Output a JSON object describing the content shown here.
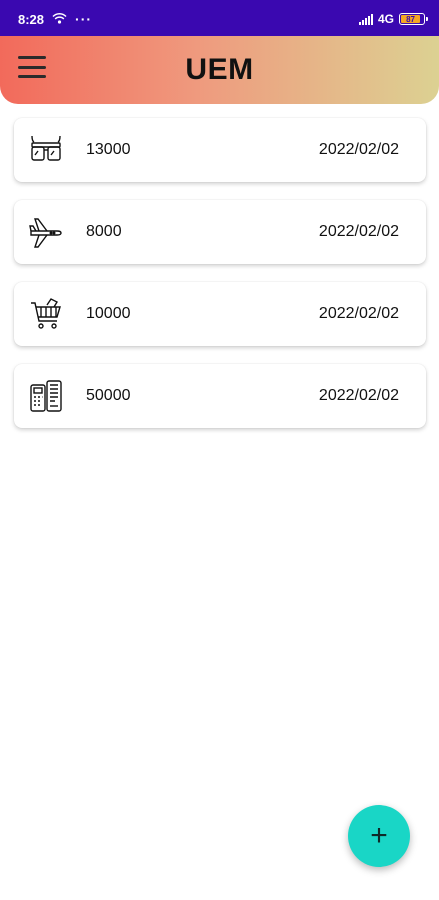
{
  "status_bar": {
    "time": "8:28",
    "network": "4G",
    "battery": "87",
    "icons": [
      "wifi-icon",
      "more-dots-icon",
      "signal-icon",
      "battery-icon"
    ]
  },
  "header": {
    "title": "UEM",
    "menu_icon": "hamburger-menu-icon"
  },
  "transactions": [
    {
      "icon": "glasses-icon",
      "amount": "13000",
      "date": "2022/02/02"
    },
    {
      "icon": "airplane-icon",
      "amount": "8000",
      "date": "2022/02/02"
    },
    {
      "icon": "shopping-cart-icon",
      "amount": "10000",
      "date": "2022/02/02"
    },
    {
      "icon": "payment-terminal-icon",
      "amount": "50000",
      "date": "2022/02/02"
    }
  ],
  "fab": {
    "label": "+",
    "icon": "add-icon"
  },
  "colors": {
    "status_bar": "#3a08b0",
    "header_gradient_start": "#f26a5b",
    "header_gradient_end": "#dcd192",
    "fab": "#19d6c6"
  }
}
